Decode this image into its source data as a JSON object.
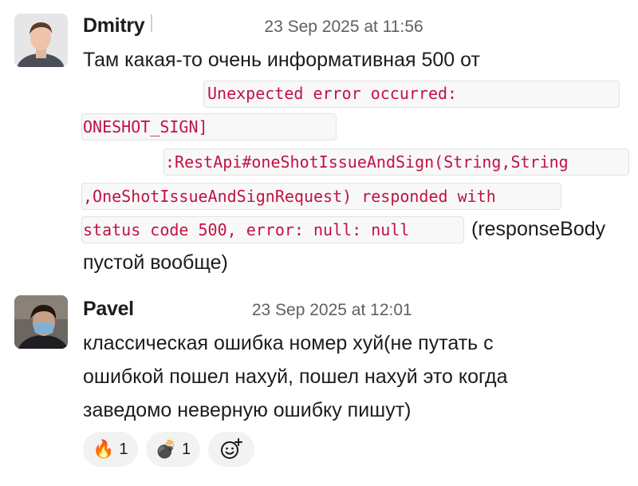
{
  "messages": [
    {
      "author": "Dmitry",
      "timestamp": "23 Sep 2025 at 11:56",
      "text_line1": "Там какая-то очень информативная 500 от",
      "code_lines": [
        "Unexpected error occurred:",
        "ONESHOT_SIGN]",
        ":RestApi#oneShotIssueAndSign(String,String",
        ",OneShotIssueAndSignRequest) responded with",
        "status code 500, error: null: null"
      ],
      "text_after_code": "(responseBody",
      "text_last_line": "пустой вообще)"
    },
    {
      "author": "Pavel",
      "timestamp": "23 Sep 2025 at 12:01",
      "lines": [
        "классическая ошибка номер хуй(не путать с",
        "ошибкой пошел нахуй, пошел нахуй это когда",
        "заведомо неверную ошибку пишут)"
      ]
    }
  ],
  "reactions": [
    {
      "emoji": "fire-icon",
      "glyph": "🔥",
      "count": "1"
    },
    {
      "emoji": "bomb-icon",
      "glyph": "💣",
      "count": "1"
    }
  ],
  "colors": {
    "code_text": "#c01343",
    "code_bg": "#f8f8f8",
    "timestamp": "#616061",
    "reaction_bg": "#f2f2f2"
  }
}
